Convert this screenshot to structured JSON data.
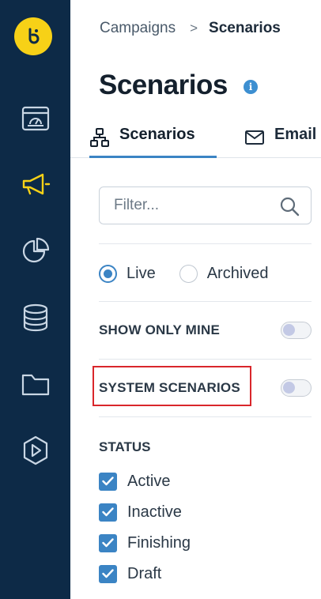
{
  "colors": {
    "rail_bg": "#0d2a47",
    "accent_yellow": "#f7d117",
    "primary_blue": "#3b84c4",
    "highlight_red": "#d9262b"
  },
  "nav": {
    "logo_icon": "brand-logo-icon",
    "items": [
      {
        "icon": "dashboard-icon"
      },
      {
        "icon": "megaphone-icon",
        "active": true
      },
      {
        "icon": "pie-chart-icon"
      },
      {
        "icon": "database-icon"
      },
      {
        "icon": "folder-icon"
      },
      {
        "icon": "play-hexagon-icon"
      }
    ]
  },
  "breadcrumb": {
    "parent": "Campaigns",
    "separator": ">",
    "current": "Scenarios"
  },
  "page": {
    "title": "Scenarios",
    "info_icon": "i"
  },
  "tabs": [
    {
      "label": "Scenarios",
      "icon": "hierarchy-icon",
      "selected": true
    },
    {
      "label": "Email",
      "icon": "envelope-icon",
      "selected": false
    }
  ],
  "filter": {
    "placeholder": "Filter...",
    "value": ""
  },
  "state": {
    "options": [
      {
        "label": "Live",
        "selected": true
      },
      {
        "label": "Archived",
        "selected": false
      }
    ]
  },
  "toggles": {
    "show_only_mine": {
      "label": "SHOW ONLY MINE",
      "on": false
    },
    "system_scenarios": {
      "label": "SYSTEM SCENARIOS",
      "on": false
    }
  },
  "status": {
    "heading": "STATUS",
    "items": [
      {
        "label": "Active",
        "checked": true
      },
      {
        "label": "Inactive",
        "checked": true
      },
      {
        "label": "Finishing",
        "checked": true
      },
      {
        "label": "Draft",
        "checked": true
      }
    ]
  }
}
